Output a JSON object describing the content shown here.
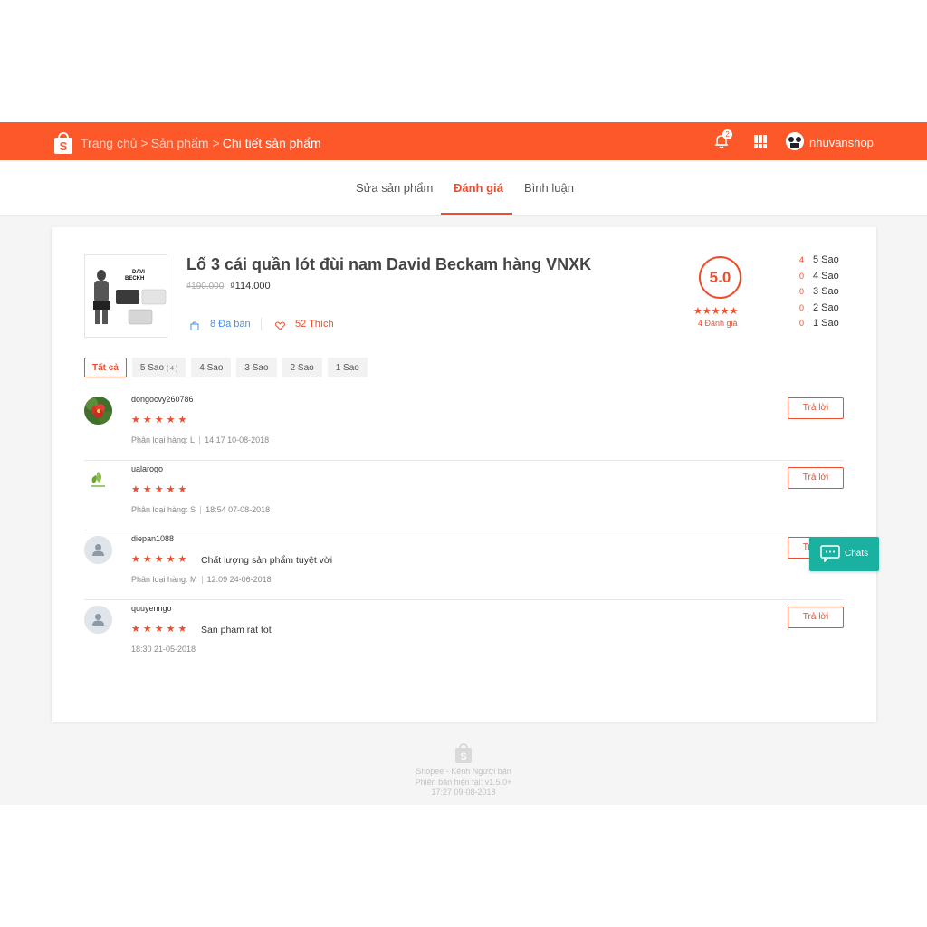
{
  "header": {
    "breadcrumbs": [
      "Trang chủ",
      "Sản phẩm",
      "Chi tiết sản phẩm"
    ],
    "separator": ">",
    "notification_count": "2",
    "username": "nhuvanshop",
    "accent": "#fd5829"
  },
  "tabs": [
    {
      "label": "Sửa sản phẩm"
    },
    {
      "label": "Đánh giá",
      "active": true
    },
    {
      "label": "Bình luận"
    }
  ],
  "product": {
    "title": "Lố 3 cái quần lót đùi nam David Beckam hàng VNXK",
    "old_price": "₫190.000",
    "price": "₫114.000",
    "sold": "8 Đã bán",
    "likes": "52 Thích",
    "image_text_line1": "DAVI",
    "image_text_line2": "BECKH"
  },
  "rating": {
    "score": "5.0",
    "stars": "★★★★★",
    "count_label": "4 Đánh giá",
    "distribution": [
      {
        "count": "4",
        "label": "5 Sao"
      },
      {
        "count": "0",
        "label": "4 Sao"
      },
      {
        "count": "0",
        "label": "3 Sao"
      },
      {
        "count": "0",
        "label": "2 Sao"
      },
      {
        "count": "0",
        "label": "1 Sao"
      }
    ]
  },
  "filters": {
    "all": "Tất cả",
    "five": "5 Sao",
    "five_count": "( 4 )",
    "four": "4 Sao",
    "three": "3 Sao",
    "two": "2 Sao",
    "one": "1 Sao"
  },
  "reviews": [
    {
      "user": "dongocvy260786",
      "stars": "★★★★★",
      "comment": "",
      "variant": "Phân loại hàng: L",
      "time": "14:17 10-08-2018",
      "avatar": "flower-avatar"
    },
    {
      "user": "ualarogo",
      "stars": "★★★★★",
      "comment": "",
      "variant": "Phân loại hàng: S",
      "time": "18:54 07-08-2018",
      "avatar": "leaf-logo-avatar"
    },
    {
      "user": "diepan1088",
      "stars": "★★★★★",
      "comment": "Chất lượng sản phẩm tuyệt vời",
      "variant": "Phân loại hàng: M",
      "time": "12:09 24-06-2018",
      "avatar": "default-user-avatar"
    },
    {
      "user": "quuyenngo",
      "stars": "★★★★★",
      "comment": "San pham rat tot",
      "variant": "",
      "time": "18:30 21-05-2018",
      "avatar": "default-user-avatar"
    }
  ],
  "reply_label": "Trả lời",
  "chat_label": "Chats",
  "footer": {
    "line1": "Shopee - Kênh Người bán",
    "line2": "Phiên bản hiện tại: v1.5.0+",
    "line3": "17:27 09-08-2018"
  }
}
